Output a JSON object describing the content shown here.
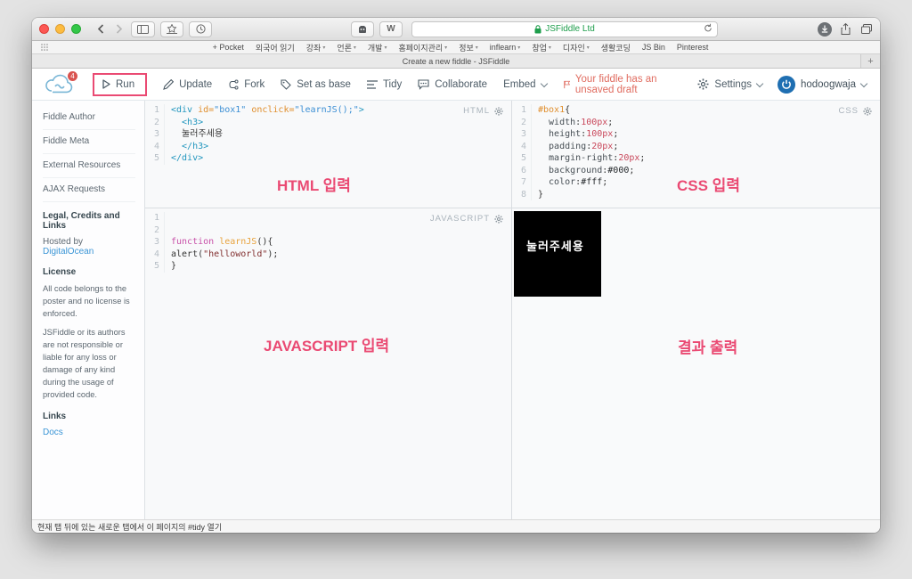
{
  "browser": {
    "url_text": "JSFiddle Ltd",
    "tab_title": "Create a new fiddle - JSFiddle",
    "new_tab_label": "+",
    "wikipedia_label": "W",
    "bookmarks": [
      {
        "label": "+ Pocket",
        "caret": false
      },
      {
        "label": "외국어 읽기",
        "caret": false
      },
      {
        "label": "강좌",
        "caret": true
      },
      {
        "label": "언론",
        "caret": true
      },
      {
        "label": "개발",
        "caret": true
      },
      {
        "label": "홈페이지관리",
        "caret": true
      },
      {
        "label": "정보",
        "caret": true
      },
      {
        "label": "inflearn",
        "caret": true
      },
      {
        "label": "창업",
        "caret": true
      },
      {
        "label": "디자인",
        "caret": true
      },
      {
        "label": "생활코딩",
        "caret": false
      },
      {
        "label": "JS Bin",
        "caret": false
      },
      {
        "label": "Pinterest",
        "caret": false
      }
    ],
    "status_text": "현재 탭 뒤에 있는 새로운 탭에서 이 페이지의 #tidy 열기"
  },
  "header": {
    "logo_badge": "4",
    "run_label": "Run",
    "actions": [
      {
        "label": "Update"
      },
      {
        "label": "Fork"
      },
      {
        "label": "Set as base"
      },
      {
        "label": "Tidy"
      },
      {
        "label": "Collaborate"
      },
      {
        "label": "Embed"
      }
    ],
    "draft_message": "Your fiddle has an unsaved draft",
    "settings_label": "Settings",
    "username": "hodoogwaja"
  },
  "sidebar": {
    "sections": [
      {
        "label": "Fiddle Author"
      },
      {
        "label": "Fiddle Meta"
      },
      {
        "label": "External Resources"
      },
      {
        "label": "AJAX Requests"
      }
    ],
    "legal_heading": "Legal, Credits and Links",
    "hosted_prefix": "Hosted by ",
    "hosted_link": "DigitalOcean",
    "license_heading": "License",
    "license_p1": "All code belongs to the poster and no license is enforced.",
    "license_p2": "JSFiddle or its authors are not responsible or liable for any loss or damage of any kind during the usage of provided code.",
    "links_heading": "Links",
    "docs_link": "Docs"
  },
  "panes": {
    "html": {
      "label": "HTML",
      "lines": [
        [
          {
            "c": "tag",
            "t": "<div "
          },
          {
            "c": "attr",
            "t": "id="
          },
          {
            "c": "str",
            "t": "\"box1\""
          },
          {
            "c": "tag",
            "t": " "
          },
          {
            "c": "attr",
            "t": "onclick="
          },
          {
            "c": "str",
            "t": "\"learnJS();\""
          },
          {
            "c": "tag",
            "t": ">"
          }
        ],
        [
          {
            "c": "tag",
            "t": "  <h3>"
          }
        ],
        [
          {
            "c": "plain",
            "t": "  눌러주세용"
          }
        ],
        [
          {
            "c": "tag",
            "t": "  </h3>"
          }
        ],
        [
          {
            "c": "tag",
            "t": "</div>"
          }
        ]
      ]
    },
    "css": {
      "label": "CSS",
      "lines": [
        [
          {
            "c": "attr",
            "t": "#box1"
          },
          {
            "c": "plain",
            "t": "{"
          }
        ],
        [
          {
            "c": "prop",
            "t": "  width"
          },
          {
            "c": "plain",
            "t": ":"
          },
          {
            "c": "num",
            "t": "100px"
          },
          {
            "c": "plain",
            "t": ";"
          }
        ],
        [
          {
            "c": "prop",
            "t": "  height"
          },
          {
            "c": "plain",
            "t": ":"
          },
          {
            "c": "num",
            "t": "100px"
          },
          {
            "c": "plain",
            "t": ";"
          }
        ],
        [
          {
            "c": "prop",
            "t": "  padding"
          },
          {
            "c": "plain",
            "t": ":"
          },
          {
            "c": "num",
            "t": "20px"
          },
          {
            "c": "plain",
            "t": ";"
          }
        ],
        [
          {
            "c": "prop",
            "t": "  margin-right"
          },
          {
            "c": "plain",
            "t": ":"
          },
          {
            "c": "num",
            "t": "20px"
          },
          {
            "c": "plain",
            "t": ";"
          }
        ],
        [
          {
            "c": "prop",
            "t": "  background"
          },
          {
            "c": "plain",
            "t": ":"
          },
          {
            "c": "hex",
            "t": "#000"
          },
          {
            "c": "plain",
            "t": ";"
          }
        ],
        [
          {
            "c": "prop",
            "t": "  color"
          },
          {
            "c": "plain",
            "t": ":"
          },
          {
            "c": "hex",
            "t": "#fff"
          },
          {
            "c": "plain",
            "t": ";"
          }
        ],
        [
          {
            "c": "plain",
            "t": "}"
          }
        ]
      ]
    },
    "js": {
      "label": "JAVASCRIPT",
      "lines": [
        [],
        [],
        [
          {
            "c": "kw",
            "t": "function "
          },
          {
            "c": "fn",
            "t": "learnJS"
          },
          {
            "c": "plain",
            "t": "(){"
          }
        ],
        [
          {
            "c": "plain",
            "t": "alert("
          },
          {
            "c": "jstr",
            "t": "\"helloworld\""
          },
          {
            "c": "plain",
            "t": ");"
          }
        ],
        [
          {
            "c": "plain",
            "t": "}"
          }
        ]
      ]
    },
    "result": {
      "box_text": "눌러주세용"
    }
  },
  "annotations": {
    "html": "HTML 입력",
    "css": "CSS 입력",
    "js": "JAVASCRIPT 입력",
    "result": "결과 출력"
  },
  "colors": {
    "annotation_pink": "#ea4a73",
    "draft_salmon": "#e06c60",
    "link_blue": "#3a95d6",
    "lock_green": "#1e9e4c",
    "badge_red": "#d9534f",
    "result_box_bg": "#000000",
    "result_box_text": "#ffffff"
  }
}
